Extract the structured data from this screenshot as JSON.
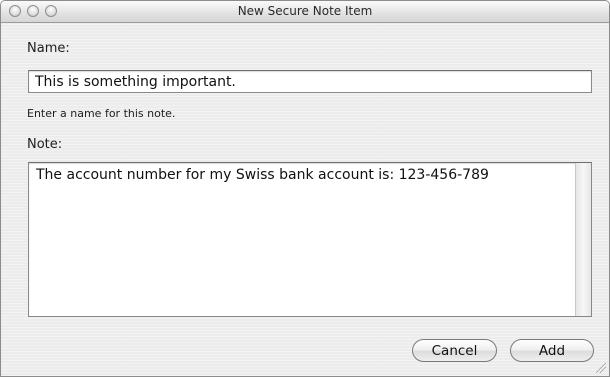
{
  "window": {
    "title": "New Secure Note Item",
    "traffic_lights": [
      "close-button",
      "minimize-button",
      "zoom-button"
    ]
  },
  "form": {
    "name_label": "Name:",
    "name_value": "This is something important.",
    "name_hint": "Enter a name for this note.",
    "note_label": "Note:",
    "note_value": "The account number for my Swiss bank account is: 123-456-789"
  },
  "buttons": {
    "cancel_label": "Cancel",
    "add_label": "Add"
  }
}
